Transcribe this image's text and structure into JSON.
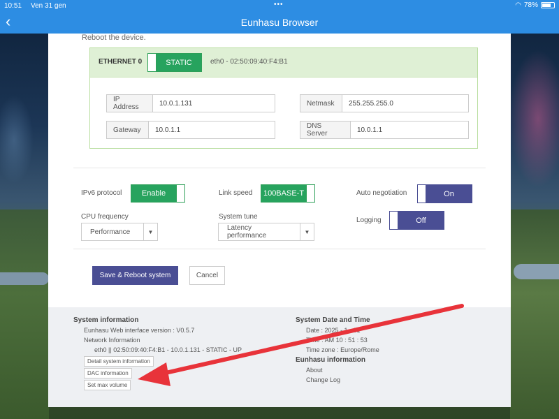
{
  "statusbar": {
    "time": "10:51",
    "date": "Ven 31 gen",
    "dots": "•••",
    "battery": "78%",
    "battery_level": 0.78
  },
  "navbar": {
    "back_icon": "chevron-left-icon",
    "title": "Eunhasu Browser"
  },
  "panel": {
    "reboot_text": "Reboot the device.",
    "ethernet": {
      "title": "ETHERNET 0",
      "mode": "STATIC",
      "mac": "eth0  -  02:50:09:40:F4:B1",
      "fields": {
        "ip": {
          "label": "IP Address",
          "value": "10.0.1.131"
        },
        "netmask": {
          "label": "Netmask",
          "value": "255.255.255.0"
        },
        "gateway": {
          "label": "Gateway",
          "value": "10.0.1.1"
        },
        "dns": {
          "label": "DNS Server",
          "value": "10.0.1.1"
        }
      }
    },
    "options": {
      "ipv6": {
        "label": "IPv6 protocol",
        "value": "Enable"
      },
      "link_speed": {
        "label": "Link speed",
        "value": "100BASE-T"
      },
      "auto_negotiation": {
        "label": "Auto negotiation",
        "value": "On"
      },
      "cpu_frequency": {
        "label": "CPU frequency",
        "value": "Performance"
      },
      "system_tune": {
        "label": "System tune",
        "value": "Latency performance"
      },
      "logging": {
        "label": "Logging",
        "value": "Off"
      }
    },
    "buttons": {
      "save": "Save & Reboot system",
      "cancel": "Cancel"
    }
  },
  "footer": {
    "system_info": {
      "title": "System information",
      "version": "Eunhasu Web interface version : V0.5.7",
      "network_title": "Network Information",
      "network_line": "eth0 || 02:50:09:40:F4:B1 - 10.0.1.131 - STATIC - UP",
      "buttons": [
        "Detail system information",
        "DAC information",
        "Set max volume"
      ]
    },
    "datetime": {
      "title": "System Date and Time",
      "date": "Date : 2025 - 1 - 31",
      "time": "Time : AM 10 : 51 : 53",
      "timezone": "Time zone : Europe/Rome"
    },
    "eunhasu": {
      "title": "Eunhasu information",
      "links": [
        "About",
        "Change Log"
      ]
    }
  },
  "colors": {
    "bar_blue": "#2d8de3",
    "green_toggle": "#27a35e",
    "indigo": "#4a4e94",
    "annotation_arrow": "#e8333a"
  }
}
